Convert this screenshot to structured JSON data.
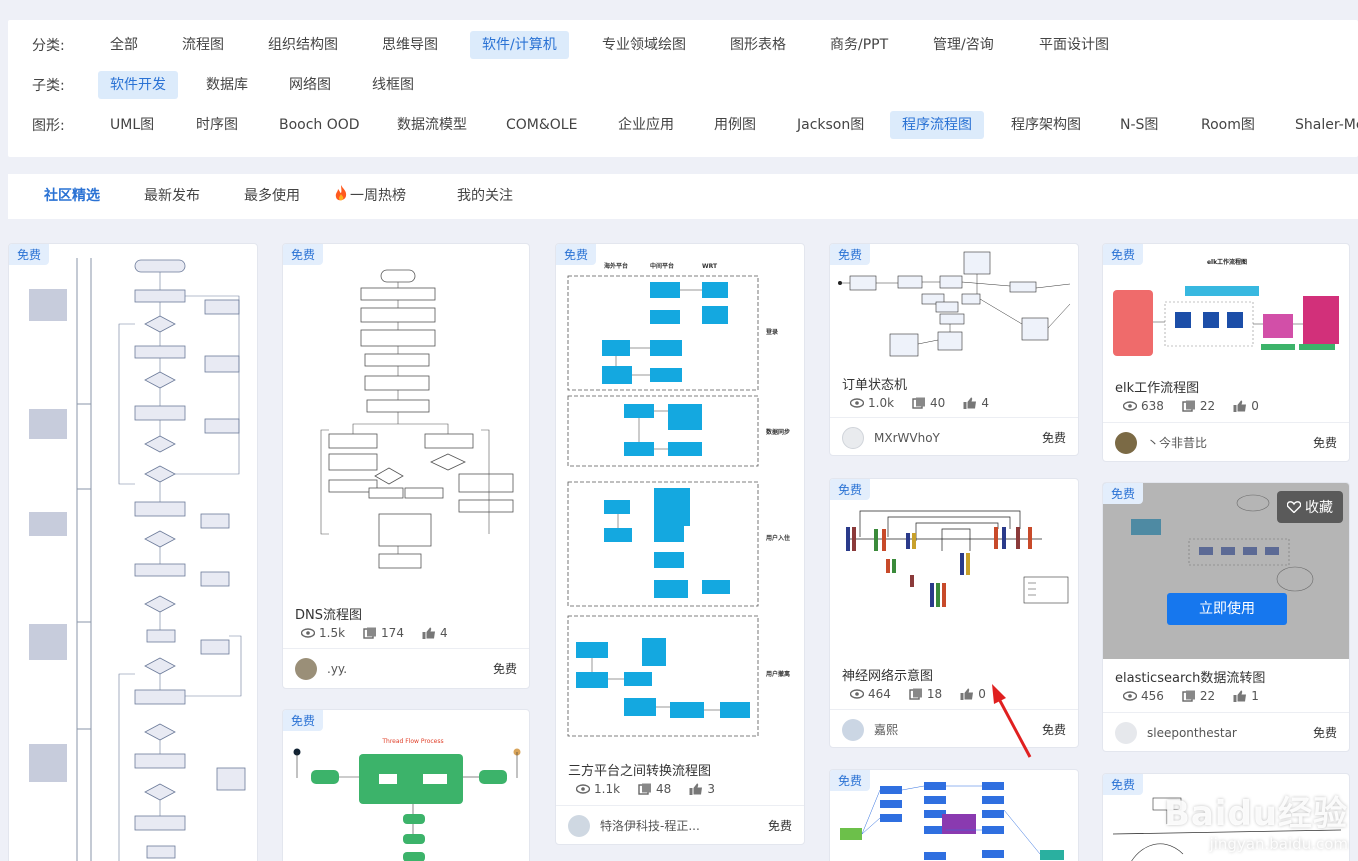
{
  "filters": {
    "category": {
      "label": "分类:",
      "items": [
        "全部",
        "流程图",
        "组织结构图",
        "思维导图",
        "软件/计算机",
        "专业领域绘图",
        "图形表格",
        "商务/PPT",
        "管理/咨询",
        "平面设计图"
      ],
      "active": "软件/计算机"
    },
    "subcategory": {
      "label": "子类:",
      "items": [
        "软件开发",
        "数据库",
        "网络图",
        "线框图"
      ],
      "active": "软件开发"
    },
    "shape": {
      "label": "图形:",
      "items": [
        "UML图",
        "时序图",
        "Booch OOD",
        "数据流模型",
        "COM&OLE",
        "企业应用",
        "用例图",
        "Jackson图",
        "程序流程图",
        "程序架构图",
        "N-S图",
        "Room图",
        "Shaler-Me"
      ],
      "active": "程序流程图"
    }
  },
  "tabs": [
    "社区精选",
    "最新发布",
    "最多使用",
    "一周热榜",
    "我的关注"
  ],
  "active_tab": "社区精选",
  "badge_label": "免费",
  "cards": {
    "dns": {
      "title": "DNS流程图",
      "views": "1.5k",
      "copies": "174",
      "likes": "4",
      "author": ".yy.",
      "price": "免费"
    },
    "sanfang": {
      "title": "三方平台之间转换流程图",
      "views": "1.1k",
      "copies": "48",
      "likes": "3",
      "author": "特洛伊科技-程正...",
      "price": "免费",
      "cols": [
        "海外平台",
        "中间平台",
        "WRT"
      ],
      "rows": [
        "登录",
        "数据同步",
        "用户入住",
        "用户撤离"
      ]
    },
    "order": {
      "title": "订单状态机",
      "views": "1.0k",
      "copies": "40",
      "likes": "4",
      "author": "MXrWVhoY",
      "price": "免费"
    },
    "nn": {
      "title": "神经网络示意图",
      "views": "464",
      "copies": "18",
      "likes": "0",
      "author": "嘉熙",
      "price": "免费"
    },
    "elk": {
      "title": "elk工作流程图",
      "views": "638",
      "copies": "22",
      "likes": "0",
      "author": "丶今非昔比",
      "price": "免费",
      "thumb_title": "elk工作流程图"
    },
    "es": {
      "title": "elasticsearch数据流转图",
      "views": "456",
      "copies": "22",
      "likes": "1",
      "author": "sleeponthestar",
      "price": "免费",
      "fav": "收藏",
      "use": "立即使用"
    },
    "thread": {
      "thumb_title": "Thread Flow Process"
    }
  },
  "watermark": {
    "line1": "Baidu经验",
    "line2": "jingyan.baidu.com"
  },
  "colors": {
    "accent": "#2a72d4",
    "primary_button": "#1677ee",
    "active_chip": "#dcebfb",
    "arrow": "#e02020"
  }
}
